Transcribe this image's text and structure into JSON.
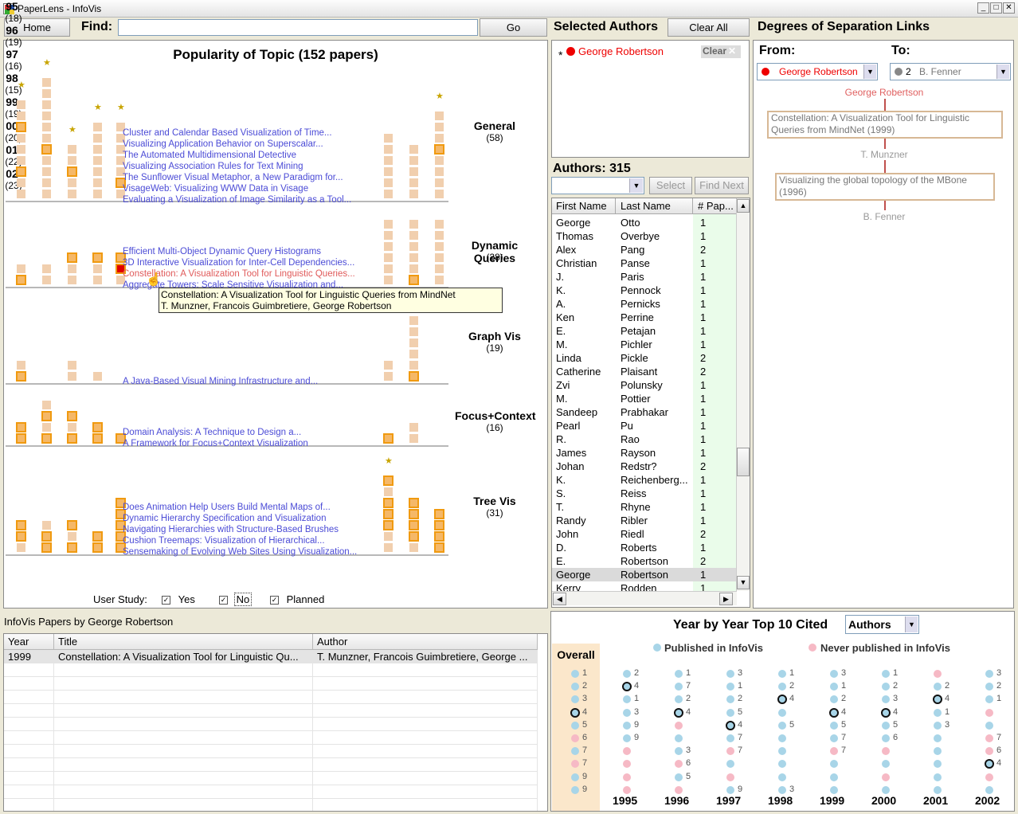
{
  "window": {
    "title": "PaperLens - InfoVis"
  },
  "toolbar": {
    "home": "Home",
    "find_label": "Find:",
    "find_value": "",
    "go": "Go"
  },
  "popularity": {
    "title": "Popularity of Topic (152 papers)",
    "groups": [
      {
        "name": "General",
        "count": "(58)",
        "papers": [
          "Cluster and Calendar Based Visualization of Time...",
          "Visualizing Application Behavior on Superscalar...",
          "The Automated Multidimensional Detective",
          "Visualizing Association Rules for Text Mining",
          "The Sunflower Visual Metaphor, a New Paradigm for...",
          "VisageWeb: Visualizing WWW Data in Visage",
          "Evaluating a Visualization of Image Similarity as a Tool..."
        ]
      },
      {
        "name": "Dynamic Queries",
        "count": "(28)",
        "papers": [
          "Efficient Multi-Object Dynamic Query Histograms",
          "3D Interactive Visualization for Inter-Cell Dependencies...",
          "Constellation: A Visualization Tool for Linguistic Queries...",
          "Aggregate Towers: Scale Sensitive Visualization and..."
        ]
      },
      {
        "name": "Graph Vis",
        "count": "(19)",
        "papers": [
          "A Java-Based Visual Mining Infrastructure and..."
        ]
      },
      {
        "name": "Focus+Context",
        "count": "(16)",
        "papers": [
          "Domain Analysis: A Technique to Design a...",
          "A Framework for Focus+Context Visualization"
        ]
      },
      {
        "name": "Tree Vis",
        "count": "(31)",
        "papers": [
          "Does Animation Help Users Build Mental Maps of...",
          "Dynamic Hierarchy Specification and Visualization",
          "Navigating Hierarchies with Structure-Based Brushes",
          "Cushion Treemaps: Visualization of Hierarchical...",
          "Sensemaking of Evolving Web Sites Using Visualization..."
        ]
      }
    ],
    "years": [
      {
        "label": "95",
        "count": "(18)"
      },
      {
        "label": "96",
        "count": "(19)"
      },
      {
        "label": "97",
        "count": "(16)"
      },
      {
        "label": "98",
        "count": "(15)"
      },
      {
        "label": "99",
        "count": "(19)"
      },
      {
        "label": "00",
        "count": "(20)"
      },
      {
        "label": "01",
        "count": "(22)"
      },
      {
        "label": "02",
        "count": "(23)"
      }
    ],
    "tooltip": {
      "line1": "Constellation: A Visualization Tool for Linguistic Queries from MindNet",
      "line2": "T. Munzner, Francois Guimbretiere, George Robertson"
    },
    "user_study": {
      "label": "User Study:",
      "yes": "Yes",
      "no": "No",
      "planned": "Planned"
    }
  },
  "selected_authors": {
    "title": "Selected Authors",
    "clear_all": "Clear All",
    "author": "George Robertson",
    "clear": "Clear",
    "marker": "*"
  },
  "authors": {
    "title": "Authors: 315",
    "select": "Select",
    "find_next": "Find Next",
    "columns": [
      "First Name",
      "Last Name",
      "# Pap..."
    ],
    "rows": [
      [
        "George",
        "Otto",
        "1"
      ],
      [
        "Thomas",
        "Overbye",
        "1"
      ],
      [
        "Alex",
        "Pang",
        "2"
      ],
      [
        "Christian",
        "Panse",
        "1"
      ],
      [
        "J.",
        "Paris",
        "1"
      ],
      [
        "K.",
        "Pennock",
        "1"
      ],
      [
        "A.",
        "Pernicks",
        "1"
      ],
      [
        "Ken",
        "Perrine",
        "1"
      ],
      [
        "E.",
        "Petajan",
        "1"
      ],
      [
        "M.",
        "Pichler",
        "1"
      ],
      [
        "Linda",
        "Pickle",
        "2"
      ],
      [
        "Catherine",
        "Plaisant",
        "2"
      ],
      [
        "Zvi",
        "Polunsky",
        "1"
      ],
      [
        "M.",
        "Pottier",
        "1"
      ],
      [
        "Sandeep",
        "Prabhakar",
        "1"
      ],
      [
        "Pearl",
        "Pu",
        "1"
      ],
      [
        "R.",
        "Rao",
        "1"
      ],
      [
        "James",
        "Rayson",
        "1"
      ],
      [
        "Johan",
        "Redstr?",
        "2"
      ],
      [
        "K.",
        "Reichenberg...",
        "1"
      ],
      [
        "S.",
        "Reiss",
        "1"
      ],
      [
        "T.",
        "Rhyne",
        "1"
      ],
      [
        "Randy",
        "Ribler",
        "1"
      ],
      [
        "John",
        "Riedl",
        "2"
      ],
      [
        "D.",
        "Roberts",
        "1"
      ],
      [
        "E.",
        "Robertson",
        "2"
      ],
      [
        "George",
        "Robertson",
        "1"
      ],
      [
        "Kerry",
        "Rodden",
        "1"
      ]
    ]
  },
  "degrees": {
    "title": "Degrees of Separation Links",
    "from_label": "From:",
    "to_label": "To:",
    "from_value": "George Robertson",
    "to_value": "B. Fenner",
    "to_count": "2",
    "chain": [
      {
        "kind": "person",
        "text": "George Robertson"
      },
      {
        "kind": "paper",
        "text": "Constellation: A Visualization Tool for Linguistic Queries from MindNet (1999)"
      },
      {
        "kind": "person",
        "text": "T. Munzner"
      },
      {
        "kind": "paper",
        "text": "Visualizing the global topology of the MBone (1996)"
      },
      {
        "kind": "person",
        "text": "B. Fenner"
      }
    ]
  },
  "papers_by": {
    "title": "InfoVis Papers by George Robertson",
    "columns": [
      "Year",
      "Title",
      "Author"
    ],
    "rows": [
      [
        "1999",
        "Constellation: A Visualization Tool for Linguistic Qu...",
        "T. Munzner, Francois Guimbretiere, George ..."
      ]
    ]
  },
  "top10": {
    "title": "Year by Year Top 10 Cited",
    "mode": "Authors",
    "legend_published": "Published in InfoVis",
    "legend_never": "Never published in InfoVis",
    "overall_label": "Overall",
    "colors": {
      "published": "#a8d5e8",
      "never": "#f6b9c5"
    },
    "overall": [
      {
        "r": "1",
        "c": "b"
      },
      {
        "r": "2",
        "c": "b"
      },
      {
        "r": "3",
        "c": "b"
      },
      {
        "r": "4",
        "c": "ring"
      },
      {
        "r": "5",
        "c": "b"
      },
      {
        "r": "6",
        "c": "p"
      },
      {
        "r": "7",
        "c": "b"
      },
      {
        "r": "7",
        "c": "p"
      },
      {
        "r": "9",
        "c": "b"
      },
      {
        "r": "9",
        "c": "b"
      }
    ],
    "years": [
      {
        "year": "1995",
        "dots": [
          {
            "r": "2",
            "c": "b"
          },
          {
            "r": "4",
            "c": "ring"
          },
          {
            "r": "1",
            "c": "b"
          },
          {
            "r": "3",
            "c": "b"
          },
          {
            "r": "9",
            "c": "b"
          },
          {
            "r": "9",
            "c": "b"
          },
          {
            "r": "",
            "c": "p"
          },
          {
            "r": "",
            "c": "p"
          },
          {
            "r": "",
            "c": "p"
          },
          {
            "r": "",
            "c": "p"
          }
        ]
      },
      {
        "year": "1996",
        "dots": [
          {
            "r": "1",
            "c": "b"
          },
          {
            "r": "7",
            "c": "b"
          },
          {
            "r": "2",
            "c": "b"
          },
          {
            "r": "4",
            "c": "ring"
          },
          {
            "r": "",
            "c": "p"
          },
          {
            "r": "",
            "c": "b"
          },
          {
            "r": "3",
            "c": "b"
          },
          {
            "r": "6",
            "c": "p"
          },
          {
            "r": "5",
            "c": "b"
          },
          {
            "r": "",
            "c": "p"
          }
        ]
      },
      {
        "year": "1997",
        "dots": [
          {
            "r": "3",
            "c": "b"
          },
          {
            "r": "1",
            "c": "b"
          },
          {
            "r": "2",
            "c": "b"
          },
          {
            "r": "5",
            "c": "b"
          },
          {
            "r": "4",
            "c": "ring"
          },
          {
            "r": "7",
            "c": "b"
          },
          {
            "r": "7",
            "c": "p"
          },
          {
            "r": "",
            "c": "b"
          },
          {
            "r": "",
            "c": "p"
          },
          {
            "r": "9",
            "c": "b"
          }
        ]
      },
      {
        "year": "1998",
        "dots": [
          {
            "r": "1",
            "c": "b"
          },
          {
            "r": "2",
            "c": "b"
          },
          {
            "r": "4",
            "c": "ring"
          },
          {
            "r": "",
            "c": "b"
          },
          {
            "r": "5",
            "c": "b"
          },
          {
            "r": "",
            "c": "b"
          },
          {
            "r": "",
            "c": "b"
          },
          {
            "r": "",
            "c": "b"
          },
          {
            "r": "",
            "c": "b"
          },
          {
            "r": "3",
            "c": "b"
          }
        ]
      },
      {
        "year": "1999",
        "dots": [
          {
            "r": "3",
            "c": "b"
          },
          {
            "r": "1",
            "c": "b"
          },
          {
            "r": "2",
            "c": "b"
          },
          {
            "r": "4",
            "c": "ring"
          },
          {
            "r": "5",
            "c": "b"
          },
          {
            "r": "7",
            "c": "b"
          },
          {
            "r": "7",
            "c": "p"
          },
          {
            "r": "",
            "c": "b"
          },
          {
            "r": "",
            "c": "b"
          },
          {
            "r": "",
            "c": "b"
          }
        ]
      },
      {
        "year": "2000",
        "dots": [
          {
            "r": "1",
            "c": "b"
          },
          {
            "r": "2",
            "c": "b"
          },
          {
            "r": "3",
            "c": "b"
          },
          {
            "r": "4",
            "c": "ring"
          },
          {
            "r": "5",
            "c": "b"
          },
          {
            "r": "6",
            "c": "b"
          },
          {
            "r": "",
            "c": "p"
          },
          {
            "r": "",
            "c": "b"
          },
          {
            "r": "",
            "c": "p"
          },
          {
            "r": "",
            "c": "b"
          }
        ]
      },
      {
        "year": "2001",
        "dots": [
          {
            "r": "",
            "c": "p"
          },
          {
            "r": "2",
            "c": "b"
          },
          {
            "r": "4",
            "c": "ring"
          },
          {
            "r": "1",
            "c": "b"
          },
          {
            "r": "3",
            "c": "b"
          },
          {
            "r": "",
            "c": "b"
          },
          {
            "r": "",
            "c": "b"
          },
          {
            "r": "",
            "c": "b"
          },
          {
            "r": "",
            "c": "b"
          },
          {
            "r": "",
            "c": "b"
          }
        ]
      },
      {
        "year": "2002",
        "dots": [
          {
            "r": "3",
            "c": "b"
          },
          {
            "r": "2",
            "c": "b"
          },
          {
            "r": "1",
            "c": "b"
          },
          {
            "r": "",
            "c": "p"
          },
          {
            "r": "",
            "c": "b"
          },
          {
            "r": "7",
            "c": "p"
          },
          {
            "r": "6",
            "c": "p"
          },
          {
            "r": "4",
            "c": "ring"
          },
          {
            "r": "",
            "c": "p"
          },
          {
            "r": "",
            "c": "b"
          }
        ]
      }
    ]
  }
}
